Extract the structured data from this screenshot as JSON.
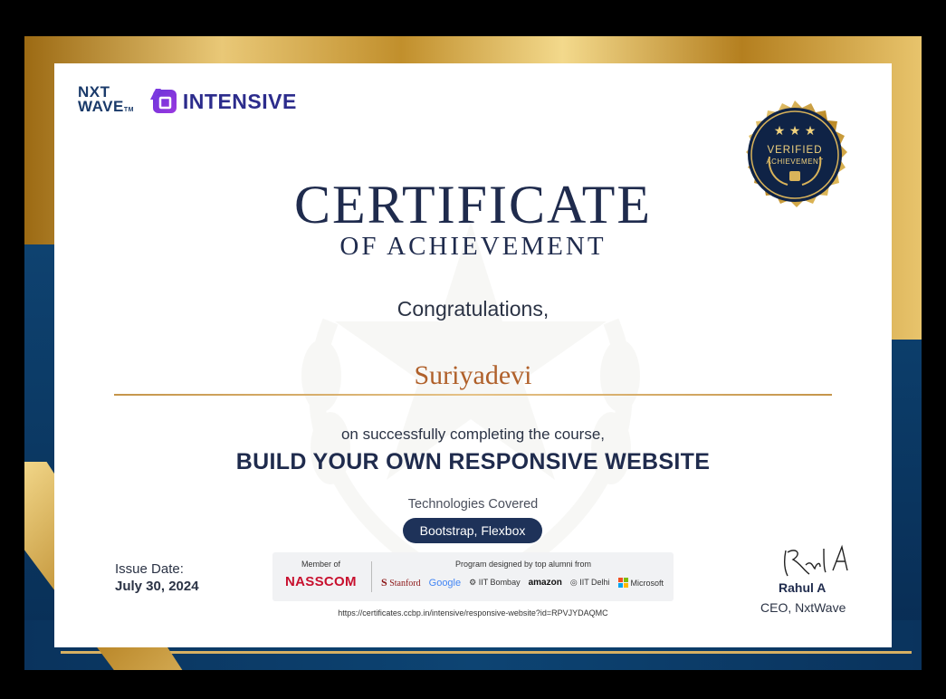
{
  "brand": {
    "nxtwave_line1": "NXT",
    "nxtwave_line2": "WAVE",
    "nxtwave_tm": "TM",
    "intensive_label": "INTENSIVE"
  },
  "seal": {
    "line1": "VERIFIED",
    "line2": "ACHIEVEMENT",
    "stars": "★ ★ ★"
  },
  "title": {
    "main": "CERTIFICATE",
    "sub": "OF ACHIEVEMENT"
  },
  "congrats": "Congratulations,",
  "recipient": "Suriyadevi",
  "completing_text": "on successfully completing the course,",
  "course_name": "BUILD YOUR OWN RESPONSIVE WEBSITE",
  "technologies": {
    "label": "Technologies Covered",
    "value": "Bootstrap, Flexbox"
  },
  "issue": {
    "label": "Issue Date:",
    "date": "July 30, 2024"
  },
  "partners": {
    "member_of": "Member of",
    "nasscom": "NASSCOM",
    "designed_by": "Program designed by top alumni from",
    "stanford": "Stanford",
    "google": "Google",
    "iit_bombay": "IIT Bombay",
    "amazon": "amazon",
    "iit_delhi": "IIT Delhi",
    "microsoft": "Microsoft"
  },
  "url": "https://certificates.ccbp.in/intensive/responsive-website?id=RPVJYDAQMC",
  "signatory": {
    "name": "Rahul A",
    "role": "CEO, NxtWave"
  },
  "colors": {
    "navy": "#1f2b4d",
    "gold": "#c5954a",
    "blue_border": "#0d4473",
    "name_accent": "#b0602a"
  }
}
